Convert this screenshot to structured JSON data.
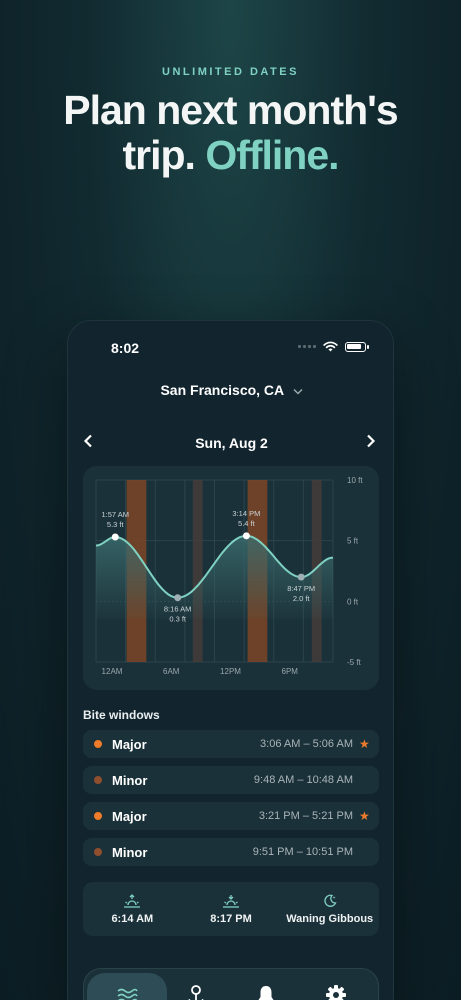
{
  "promo": {
    "eyebrow": "UNLIMITED DATES",
    "headline_line1": "Plan next month's",
    "headline_line2_prefix": "trip.",
    "headline_line2_accent": "Offline."
  },
  "status_bar": {
    "time": "8:02"
  },
  "location": {
    "name": "San Francisco, CA"
  },
  "date_nav": {
    "date": "Sun, Aug 2"
  },
  "chart_data": {
    "type": "line",
    "x_label_ticks": [
      "12AM",
      "6AM",
      "12PM",
      "6PM"
    ],
    "y_ticks": [
      "10 ft",
      "5 ft",
      "0 ft",
      "-5 ft"
    ],
    "ylim": [
      -5,
      10
    ],
    "x_range_hours": [
      0,
      24
    ],
    "series": [
      {
        "values_x_hours": [
          0,
          1.95,
          8.27,
          15.23,
          20.78,
          24
        ],
        "values_y_ft": [
          4.6,
          5.3,
          0.3,
          5.4,
          2.0,
          3.6
        ]
      }
    ],
    "extremes": [
      {
        "time": "1:57 AM",
        "height": "5.3 ft",
        "hour": 1.95,
        "ft": 5.3,
        "label_pos": "above"
      },
      {
        "time": "8:16 AM",
        "height": "0.3 ft",
        "hour": 8.27,
        "ft": 0.3,
        "label_pos": "below"
      },
      {
        "time": "3:14 PM",
        "height": "5.4 ft",
        "hour": 15.23,
        "ft": 5.4,
        "label_pos": "above"
      },
      {
        "time": "8:47 PM",
        "height": "2.0 ft",
        "hour": 20.78,
        "ft": 2.0,
        "label_pos": "below"
      }
    ],
    "bands": [
      {
        "start": 3.1,
        "end": 5.1,
        "type": "major"
      },
      {
        "start": 9.8,
        "end": 10.8,
        "type": "minor"
      },
      {
        "start": 15.35,
        "end": 17.35,
        "type": "major"
      },
      {
        "start": 21.85,
        "end": 22.85,
        "type": "minor"
      }
    ],
    "grid": true,
    "colors": {
      "line": "#7fd1c2",
      "major_band": "#7c4526",
      "minor_band": "#443c3a",
      "fill": "#3a6b6d"
    }
  },
  "bite_windows": {
    "title": "Bite windows",
    "items": [
      {
        "kind": "Major",
        "range": "3:06 AM – 5:06 AM",
        "dot_color": "#ec7b2a",
        "starred": true
      },
      {
        "kind": "Minor",
        "range": "9:48 AM – 10:48 AM",
        "dot_color": "#8f4e2d",
        "starred": false
      },
      {
        "kind": "Major",
        "range": "3:21 PM – 5:21 PM",
        "dot_color": "#ec7b2a",
        "starred": true
      },
      {
        "kind": "Minor",
        "range": "9:51 PM – 10:51 PM",
        "dot_color": "#8f4e2d",
        "starred": false
      }
    ]
  },
  "sun_moon": {
    "sunrise": "6:14 AM",
    "sunset": "8:17 PM",
    "moon_phase": "Waning Gibbous"
  },
  "tabs": [
    {
      "icon": "waves-icon",
      "active": true
    },
    {
      "icon": "location-pin-icon",
      "active": false
    },
    {
      "icon": "bell-icon",
      "active": false
    },
    {
      "icon": "gear-icon",
      "active": false
    }
  ]
}
